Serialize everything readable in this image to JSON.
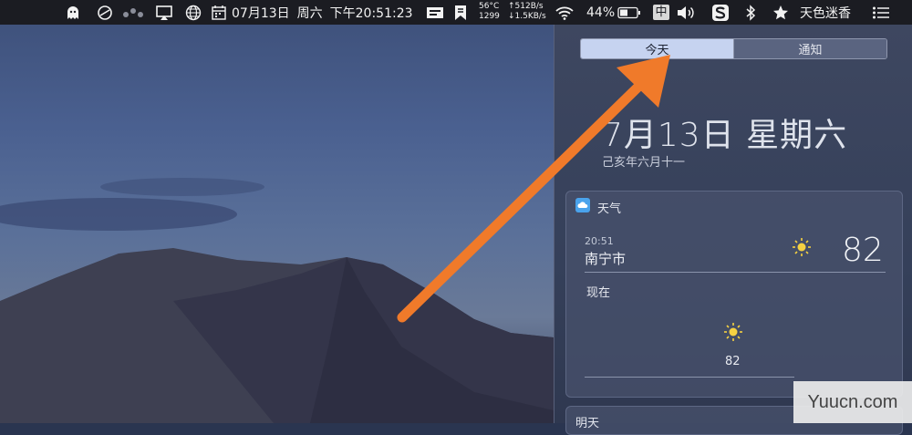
{
  "menubar": {
    "date": "07月13日",
    "weekday": "周六",
    "time": "下午20:51:23",
    "stats": {
      "temp": "56°C",
      "rpm": "1299",
      "up": "↑512B/s",
      "down": "↓1.5KB/s"
    },
    "battery": "44%",
    "input_method": "中",
    "user": "天色迷香",
    "icons": [
      "ghost-icon",
      "no-entry-icon",
      "dots-icon",
      "airplay-icon",
      "globe-icon",
      "calendar-icon",
      "display-icon",
      "bookmark-icon",
      "wifi-icon",
      "battery-icon",
      "volume-icon",
      "sogou-icon",
      "bluetooth-icon",
      "star-icon",
      "list-icon"
    ]
  },
  "notification_center": {
    "tabs": [
      "今天",
      "通知"
    ],
    "active_tab": "今天",
    "date_big": "7月13日 星期六",
    "lunar_date": "己亥年六月十一",
    "weather": {
      "title": "天气",
      "time": "20:51",
      "city": "南宁市",
      "temp": "82",
      "now_label": "现在",
      "hour_temp": "82"
    },
    "tomorrow_title": "明天"
  },
  "watermark": "Yuucn.com",
  "colors": {
    "arrow": "#f07a2a",
    "segment_active": "#c6d3f0",
    "sun": "#f5d142"
  }
}
